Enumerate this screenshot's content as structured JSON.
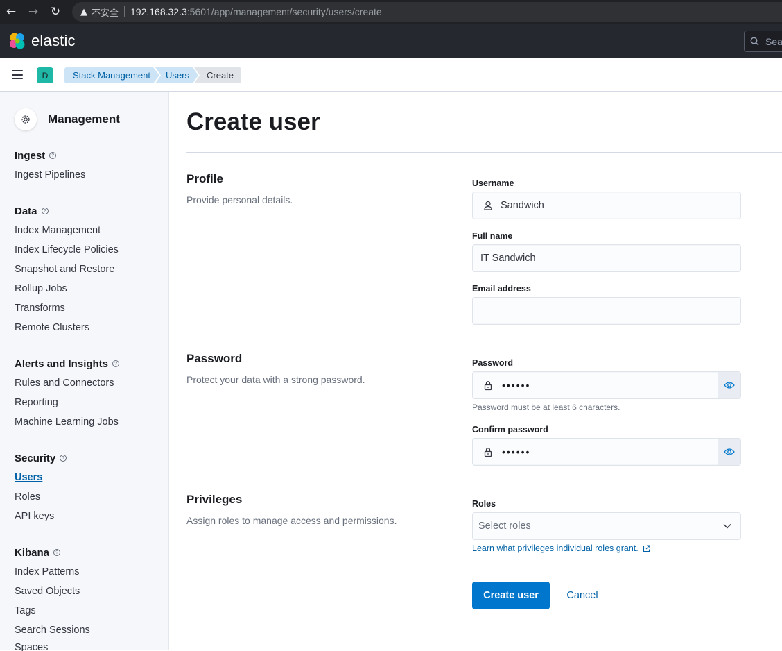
{
  "browser": {
    "insecure_label": "不安全",
    "url_host": "192.168.32.3",
    "url_path": ":5601/app/management/security/users/create"
  },
  "header": {
    "brand": "elastic",
    "search_placeholder": "Sea"
  },
  "breadcrumb": {
    "space_initial": "D",
    "items": [
      "Stack Management",
      "Users",
      "Create"
    ]
  },
  "sidebar": {
    "title": "Management",
    "sections": [
      {
        "title": "Ingest",
        "items": [
          "Ingest Pipelines"
        ]
      },
      {
        "title": "Data",
        "items": [
          "Index Management",
          "Index Lifecycle Policies",
          "Snapshot and Restore",
          "Rollup Jobs",
          "Transforms",
          "Remote Clusters"
        ]
      },
      {
        "title": "Alerts and Insights",
        "items": [
          "Rules and Connectors",
          "Reporting",
          "Machine Learning Jobs"
        ]
      },
      {
        "title": "Security",
        "items": [
          "Users",
          "Roles",
          "API keys"
        ]
      },
      {
        "title": "Kibana",
        "items": [
          "Index Patterns",
          "Saved Objects",
          "Tags",
          "Search Sessions",
          "Spaces"
        ]
      }
    ],
    "active_item": "Users"
  },
  "main": {
    "page_title": "Create user",
    "profile": {
      "title": "Profile",
      "description": "Provide personal details.",
      "username_label": "Username",
      "username_value": "Sandwich",
      "fullname_label": "Full name",
      "fullname_value": "IT Sandwich",
      "email_label": "Email address",
      "email_value": ""
    },
    "password": {
      "title": "Password",
      "description": "Protect your data with a strong password.",
      "password_label": "Password",
      "password_mask": "••••••",
      "password_help": "Password must be at least 6 characters.",
      "confirm_label": "Confirm password",
      "confirm_mask": "••••••"
    },
    "privileges": {
      "title": "Privileges",
      "description": "Assign roles to manage access and permissions.",
      "roles_label": "Roles",
      "roles_placeholder": "Select roles",
      "learn_link": "Learn what privileges individual roles grant."
    },
    "actions": {
      "create_label": "Create user",
      "cancel_label": "Cancel"
    }
  },
  "colors": {
    "primary": "#0077cc",
    "link": "#0061a6",
    "header_bg": "#25282f",
    "space_avatar": "#1fb8a6"
  }
}
